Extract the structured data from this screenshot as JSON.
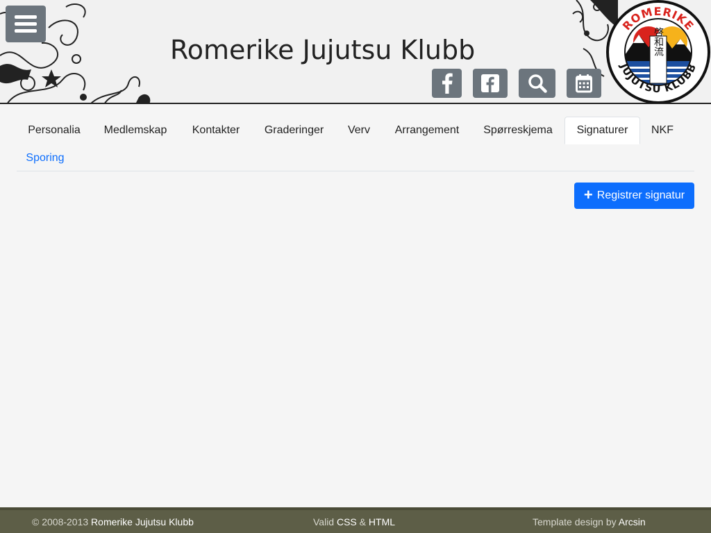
{
  "header": {
    "site_title": "Romerike Jujutsu Klubb",
    "icons": [
      "facebook-icon",
      "facebook-square-icon",
      "search-icon",
      "calendar-icon"
    ]
  },
  "logo": {
    "top_text": "ROMERIKE",
    "bottom_text": "JUJUTSU KLUBB",
    "kanji": "啓和流"
  },
  "tabs": {
    "items": [
      {
        "label": "Personalia"
      },
      {
        "label": "Medlemskap"
      },
      {
        "label": "Kontakter"
      },
      {
        "label": "Graderinger"
      },
      {
        "label": "Verv"
      },
      {
        "label": "Arrangement"
      },
      {
        "label": "Spørreskjema"
      },
      {
        "label": "Signaturer"
      },
      {
        "label": "NKF"
      },
      {
        "label": "Sporing"
      }
    ],
    "active": "Signaturer"
  },
  "actions": {
    "register_signature_label": "Registrer signatur"
  },
  "footer": {
    "copyright_prefix": "© 2008-2013",
    "copyright_name": "Romerike Jujutsu Klubb",
    "valid_prefix": "Valid",
    "valid_css": "CSS",
    "valid_amp": "&",
    "valid_html": "HTML",
    "template_prefix": "Template design by",
    "template_author": "Arcsin"
  },
  "colors": {
    "primary": "#0d6efd",
    "icon_button": "#6c757d",
    "footer_bg": "#5d5e47",
    "logo_red": "#d9231d",
    "logo_yellow": "#f6b21b",
    "logo_blue": "#1c4fa0"
  }
}
